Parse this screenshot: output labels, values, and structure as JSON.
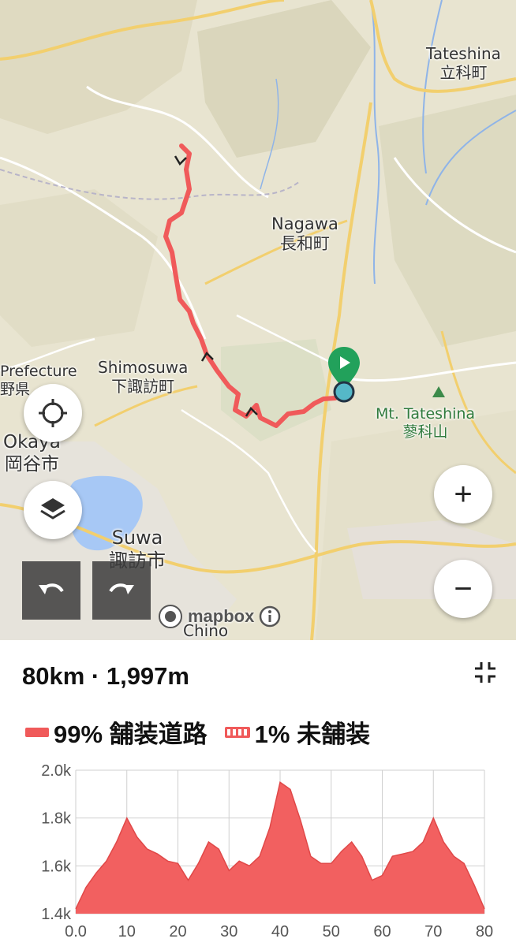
{
  "map": {
    "places": [
      {
        "en": "Tateshina",
        "ja": "立科町"
      },
      {
        "en": "Nagawa",
        "ja": "長和町"
      },
      {
        "en": "Shimosuwa",
        "ja": "下諏訪町"
      },
      {
        "en": "Okaya",
        "ja": "岡谷市"
      },
      {
        "en": "Suwa",
        "ja": "諏訪市"
      },
      {
        "en": "Mt. Tateshina",
        "ja": "蓼科山"
      },
      {
        "en": "Prefecture",
        "ja": "野県"
      },
      {
        "en": "Chino",
        "ja": ""
      }
    ],
    "attribution": "mapbox",
    "colors": {
      "route": "#f05a5a",
      "start_pin": "#1fa05a",
      "end_point": "#55b8c8"
    }
  },
  "controls": {
    "locate": "crosshair-icon",
    "layers": "layers-icon",
    "zoom_in": "+",
    "zoom_out": "−",
    "undo": "undo-icon",
    "redo": "redo-icon",
    "collapse": "collapse-icon"
  },
  "route": {
    "stats": "80km · 1,997m",
    "paved_label": "99% 舗装道路",
    "unpaved_label": "1% 未舗装"
  },
  "chart_data": {
    "type": "area",
    "x": [
      0,
      2,
      4,
      6,
      8,
      10,
      12,
      14,
      16,
      18,
      20,
      22,
      24,
      26,
      28,
      30,
      32,
      34,
      36,
      38,
      40,
      42,
      44,
      46,
      48,
      50,
      52,
      54,
      56,
      58,
      60,
      62,
      64,
      66,
      68,
      70,
      72,
      74,
      76,
      78,
      80
    ],
    "y": [
      1420,
      1510,
      1570,
      1620,
      1700,
      1800,
      1720,
      1670,
      1650,
      1620,
      1610,
      1540,
      1610,
      1700,
      1670,
      1580,
      1620,
      1600,
      1640,
      1760,
      1950,
      1920,
      1790,
      1640,
      1610,
      1610,
      1660,
      1700,
      1640,
      1540,
      1560,
      1640,
      1650,
      1660,
      1700,
      1800,
      1700,
      1640,
      1610,
      1520,
      1420
    ],
    "xlim": [
      0,
      80
    ],
    "ylim": [
      1400,
      2000
    ],
    "xticks": [
      "0.0",
      "10",
      "20",
      "30",
      "40",
      "50",
      "60",
      "70",
      "80"
    ],
    "yticks": [
      "1.4k",
      "1.6k",
      "1.8k",
      "2.0k"
    ],
    "grid": true,
    "fill_color": "#f26060"
  }
}
